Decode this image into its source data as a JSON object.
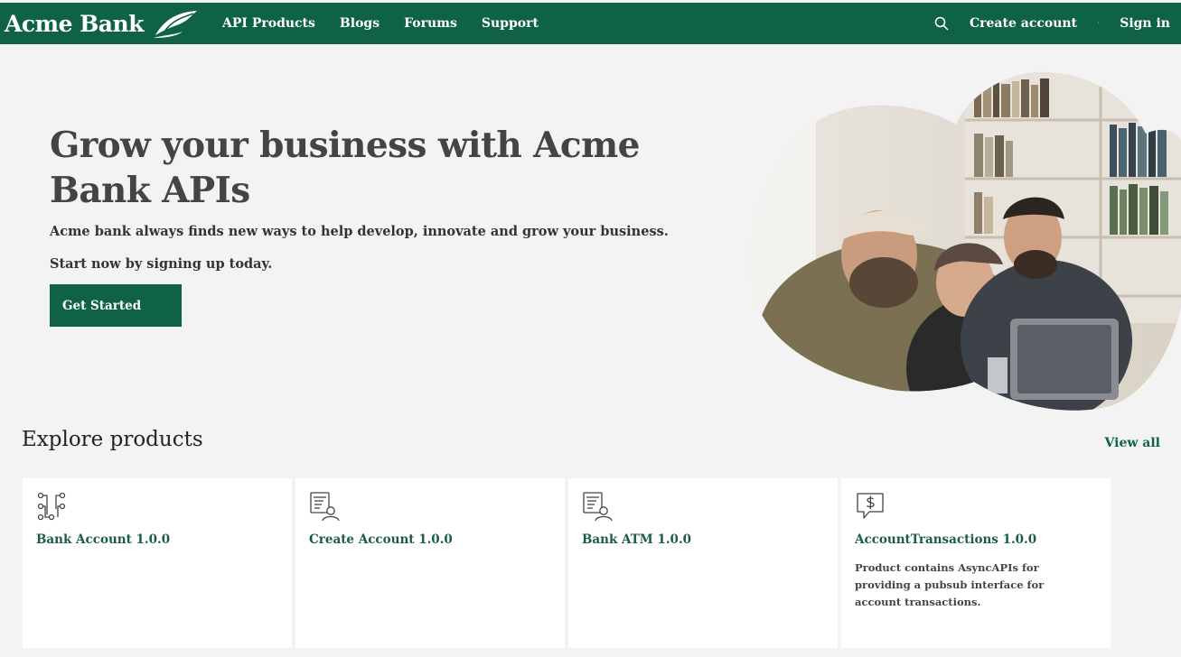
{
  "brand": {
    "name": "Acme Bank",
    "logo_icon": "leaf-icon"
  },
  "nav": {
    "items": [
      {
        "label": "API Products"
      },
      {
        "label": "Blogs"
      },
      {
        "label": "Forums"
      },
      {
        "label": "Support"
      }
    ]
  },
  "header_right": {
    "search_icon": "search-icon",
    "create_account": "Create account",
    "separator": "·",
    "sign_in": "Sign in"
  },
  "hero": {
    "title": "Grow your business with Acme Bank APIs",
    "subtitle": "Acme bank always finds new ways to help develop, innovate and grow your business.",
    "subtitle2": "Start now by signing up today.",
    "cta": "Get Started",
    "image": "people-laughing-at-laptop-photo"
  },
  "products": {
    "heading": "Explore products",
    "view_all": "View all",
    "items": [
      {
        "icon": "flow-diagram-icon",
        "title": "Bank Account 1.0.0",
        "description": ""
      },
      {
        "icon": "document-user-icon",
        "title": "Create Account 1.0.0",
        "description": ""
      },
      {
        "icon": "document-user-icon",
        "title": "Bank ATM 1.0.0",
        "description": ""
      },
      {
        "icon": "dollar-chat-icon",
        "title": "AccountTransactions 1.0.0",
        "description": "Product contains AsyncAPIs for providing a pubsub interface for account transactions."
      }
    ]
  },
  "colors": {
    "brand_green": "#0f6147",
    "page_bg": "#f3f3f3",
    "card_bg": "#ffffff",
    "link_green": "#1a5c46"
  }
}
